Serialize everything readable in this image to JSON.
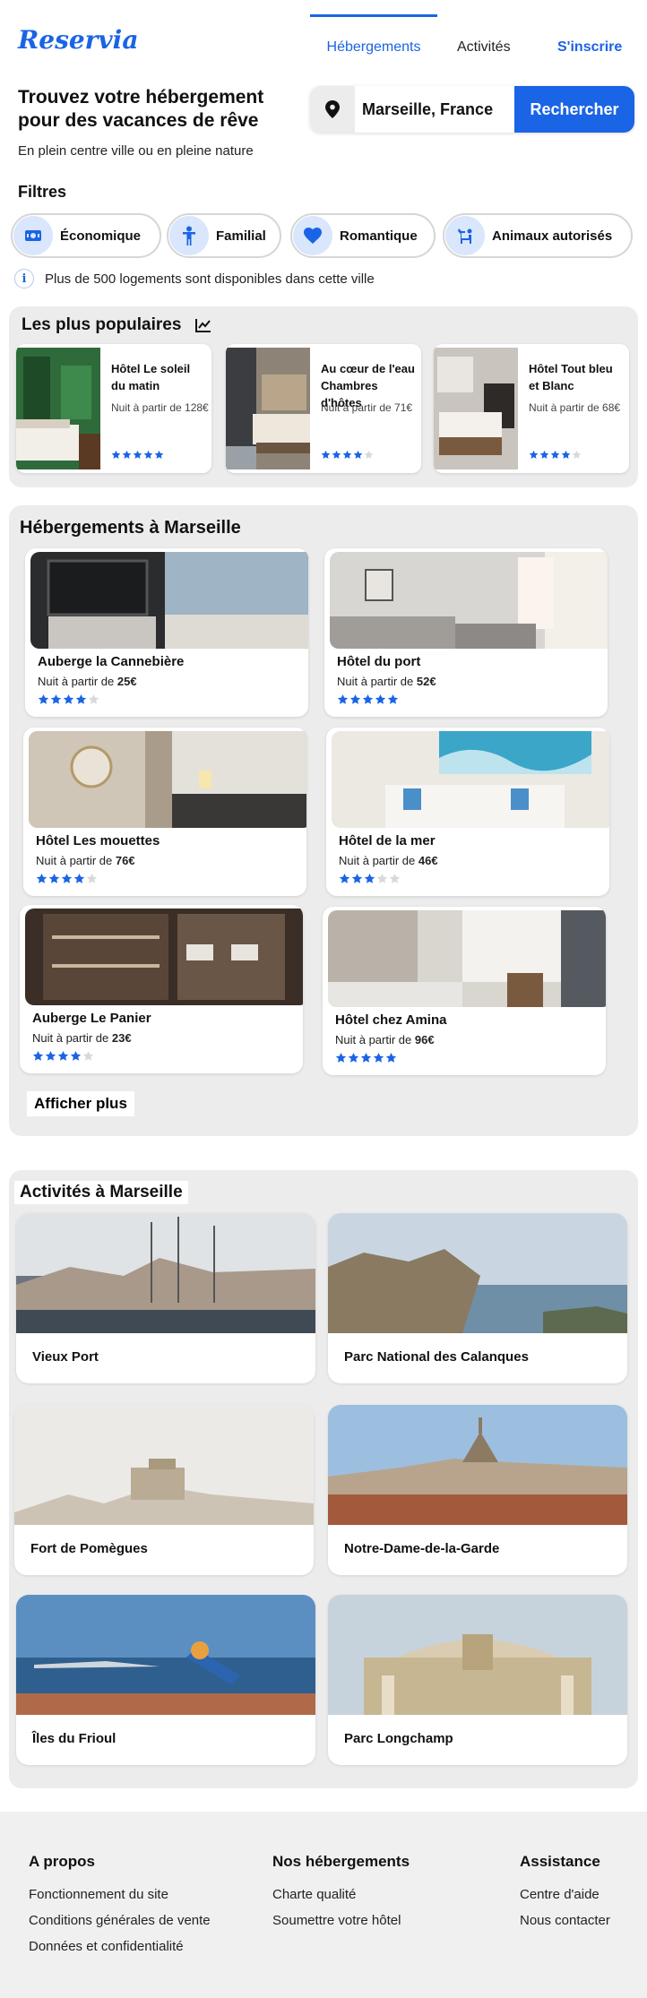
{
  "brand": {
    "logo": "Reservia",
    "accent": "#1a64e6"
  },
  "nav": {
    "accommodations": "Hébergements",
    "activities": "Activités",
    "signup": "S'inscrire"
  },
  "hero": {
    "title": "Trouvez votre hébergement pour des vacances de rêve",
    "subtitle": "En plein centre ville ou en pleine nature",
    "search_value": "Marseille, France",
    "search_button": "Rechercher",
    "search_icon": "location-pin-icon"
  },
  "filters": {
    "title": "Filtres",
    "chips": [
      {
        "label": "Économique",
        "icon": "money-icon"
      },
      {
        "label": "Familial",
        "icon": "child-icon"
      },
      {
        "label": "Romantique",
        "icon": "heart-icon"
      },
      {
        "label": "Animaux autorisés",
        "icon": "dog-icon"
      }
    ],
    "info": "Plus de 500 logements sont disponibles dans cette ville"
  },
  "popular": {
    "title": "Les plus populaires",
    "icon": "trending-chart-icon",
    "items": [
      {
        "name": "Hôtel Le soleil du matin",
        "price": "Nuit à partir de 128€",
        "rating": 5
      },
      {
        "name": "Au cœur de l'eau Chambres d'hôtes",
        "price": "Nuit à partir de 71€",
        "rating": 4
      },
      {
        "name": "Hôtel Tout bleu et Blanc",
        "price": "Nuit à partir de 68€",
        "rating": 4
      }
    ]
  },
  "accommodations": {
    "title": "Hébergements à Marseille",
    "price_prefix": "Nuit à partir de ",
    "items": [
      {
        "name": "Auberge la Cannebière",
        "price": "25€",
        "rating": 4
      },
      {
        "name": "Hôtel du port",
        "price": "52€",
        "rating": 5
      },
      {
        "name": "Hôtel Les mouettes",
        "price": "76€",
        "rating": 4
      },
      {
        "name": "Hôtel de la mer",
        "price": "46€",
        "rating": 3
      },
      {
        "name": "Auberge Le Panier",
        "price": "23€",
        "rating": 4
      },
      {
        "name": "Hôtel chez Amina",
        "price": "96€",
        "rating": 5
      }
    ],
    "show_more": "Afficher plus"
  },
  "activities": {
    "title": "Activités à Marseille",
    "items": [
      {
        "name": "Vieux Port"
      },
      {
        "name": "Parc National des Calanques"
      },
      {
        "name": "Fort de Pomègues"
      },
      {
        "name": "Notre-Dame-de-la-Garde"
      },
      {
        "name": "Îles du Frioul"
      },
      {
        "name": "Parc Longchamp"
      }
    ]
  },
  "footer": {
    "about": {
      "title": "A propos",
      "links": [
        "Fonctionnement du site",
        "Conditions générales de vente",
        "Données et confidentialité"
      ]
    },
    "hotels": {
      "title": "Nos hébergements",
      "links": [
        "Charte qualité",
        "Soumettre votre hôtel"
      ]
    },
    "help": {
      "title": "Assistance",
      "links": [
        "Centre d'aide",
        "Nous contacter"
      ]
    }
  }
}
